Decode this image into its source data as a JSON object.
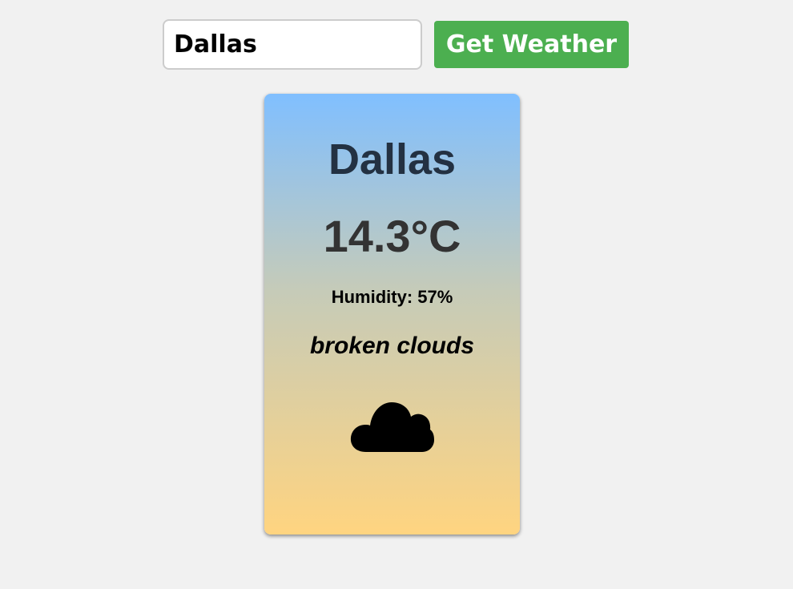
{
  "search": {
    "value": "Dallas"
  },
  "button": {
    "label": "Get Weather"
  },
  "weather": {
    "city": "Dallas",
    "temperature": "14.3°C",
    "humidity": "Humidity: 57%",
    "description": "broken clouds",
    "icon": "cloud-icon"
  },
  "colors": {
    "button": "#4caf50",
    "gradient_top": "#80bfff",
    "gradient_bottom": "#ffd480",
    "city_text": "#233142",
    "temperature_text": "#333333"
  }
}
